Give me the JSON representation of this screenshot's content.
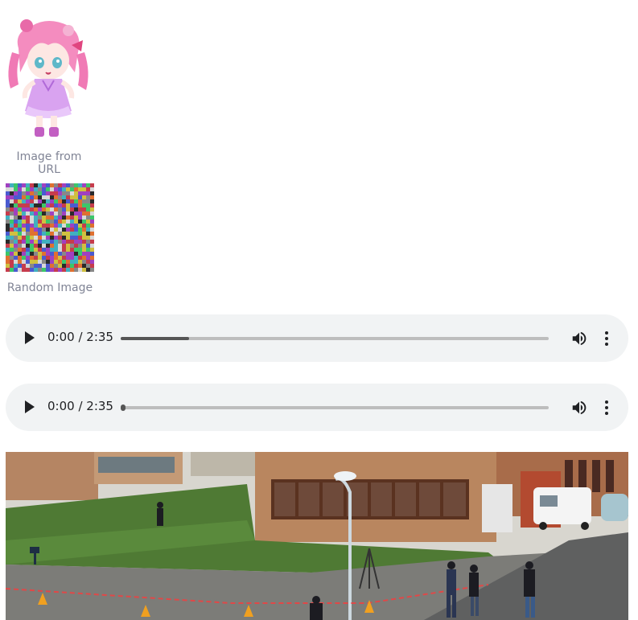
{
  "image_url": {
    "caption": "Image from URL"
  },
  "random_image": {
    "caption": "Random Image"
  },
  "audio_players": [
    {
      "time": "0:00 / 2:35",
      "progress": 0.16
    },
    {
      "time": "0:00 / 2:35",
      "progress": 0.0
    }
  ],
  "icons": {
    "play": "play-icon",
    "volume": "volume-icon",
    "more": "more-vertical-icon"
  }
}
